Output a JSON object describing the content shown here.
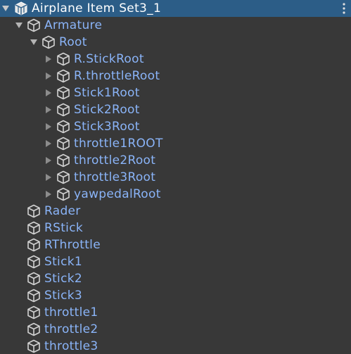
{
  "hierarchy": {
    "root": {
      "label": "Airplane Item Set3_1",
      "icon": "prefab-icon",
      "expanded": true
    },
    "items": [
      {
        "label": "Armature",
        "level": 1,
        "arrow": "expanded",
        "icon": "cube-icon"
      },
      {
        "label": "Root",
        "level": 2,
        "arrow": "expanded",
        "icon": "cube-icon"
      },
      {
        "label": "R.StickRoot",
        "level": 3,
        "arrow": "collapsed",
        "icon": "cube-icon"
      },
      {
        "label": "R.throttleRoot",
        "level": 3,
        "arrow": "collapsed",
        "icon": "cube-icon"
      },
      {
        "label": "Stick1Root",
        "level": 3,
        "arrow": "collapsed",
        "icon": "cube-icon"
      },
      {
        "label": "Stick2Root",
        "level": 3,
        "arrow": "collapsed",
        "icon": "cube-icon"
      },
      {
        "label": "Stick3Root",
        "level": 3,
        "arrow": "collapsed",
        "icon": "cube-icon"
      },
      {
        "label": "throttle1ROOT",
        "level": 3,
        "arrow": "collapsed",
        "icon": "cube-icon"
      },
      {
        "label": "throttle2Root",
        "level": 3,
        "arrow": "collapsed",
        "icon": "cube-icon"
      },
      {
        "label": "throttle3Root",
        "level": 3,
        "arrow": "collapsed",
        "icon": "cube-icon"
      },
      {
        "label": "yawpedalRoot",
        "level": 3,
        "arrow": "collapsed",
        "icon": "cube-icon"
      },
      {
        "label": "Rader",
        "level": 1,
        "arrow": "none",
        "icon": "cube-icon"
      },
      {
        "label": "RStick",
        "level": 1,
        "arrow": "none",
        "icon": "cube-icon"
      },
      {
        "label": "RThrottle",
        "level": 1,
        "arrow": "none",
        "icon": "cube-icon"
      },
      {
        "label": "Stick1",
        "level": 1,
        "arrow": "none",
        "icon": "cube-icon"
      },
      {
        "label": "Stick2",
        "level": 1,
        "arrow": "none",
        "icon": "cube-icon"
      },
      {
        "label": "Stick3",
        "level": 1,
        "arrow": "none",
        "icon": "cube-icon"
      },
      {
        "label": "throttle1",
        "level": 1,
        "arrow": "none",
        "icon": "cube-icon"
      },
      {
        "label": "throttle2",
        "level": 1,
        "arrow": "none",
        "icon": "cube-icon"
      },
      {
        "label": "throttle3",
        "level": 1,
        "arrow": "none",
        "icon": "cube-icon"
      }
    ]
  },
  "colors": {
    "background": "#383838",
    "selection": "#2c5d87",
    "prefab_text": "#8ab4f8",
    "selected_text": "#ffffff"
  }
}
